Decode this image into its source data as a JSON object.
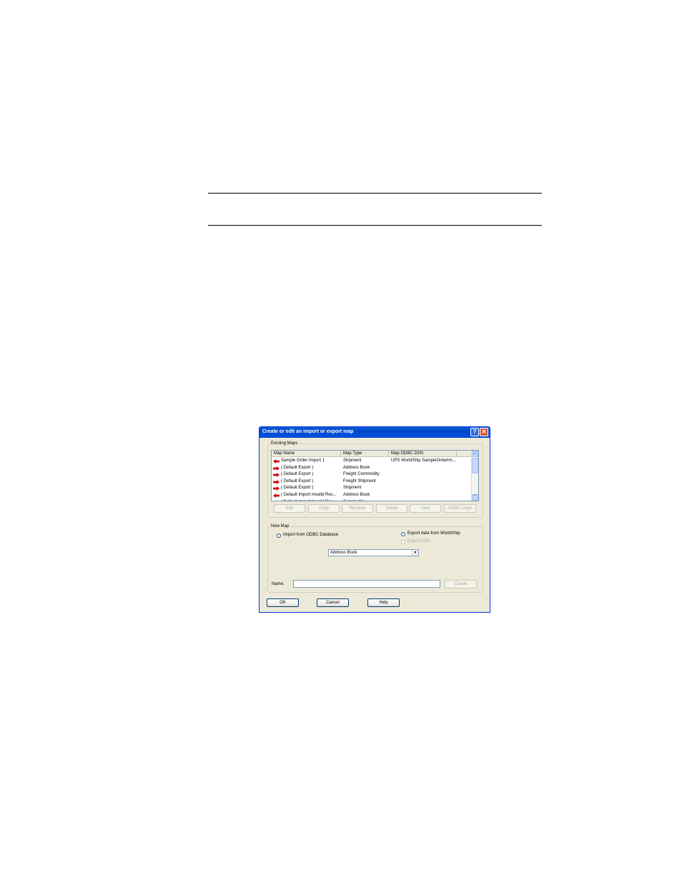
{
  "window": {
    "title": "Create or edit an import or export map",
    "help_glyph": "?",
    "close_glyph": "✕"
  },
  "existing_maps": {
    "legend": "Existing Maps",
    "columns": [
      "Map Name",
      "Map Type",
      "Map ODBC DSN"
    ],
    "rows": [
      {
        "direction": "import",
        "name": "Sample Order Import 1",
        "type": "Shipment",
        "dsn": "UPS WorldShip SampleOrderIm..."
      },
      {
        "direction": "export",
        "name": "( Default Export )",
        "type": "Address Book",
        "dsn": ""
      },
      {
        "direction": "export",
        "name": "( Default Export )",
        "type": "Freight Commodity",
        "dsn": ""
      },
      {
        "direction": "export",
        "name": "( Default Export )",
        "type": "Freight Shipment",
        "dsn": ""
      },
      {
        "direction": "export",
        "name": "( Default Export )",
        "type": "Shipment",
        "dsn": ""
      },
      {
        "direction": "import",
        "name": "( Default Import Invalid Rec...",
        "type": "Address Book",
        "dsn": ""
      },
      {
        "direction": "import",
        "name": "( Default Import Invalid Rec...",
        "type": "Commodity",
        "dsn": ""
      }
    ],
    "buttons": {
      "edit": "Edit",
      "copy": "Copy",
      "rename": "Rename",
      "delete": "Delete",
      "view": "View",
      "odbc_login": "ODBC Login"
    }
  },
  "new_map": {
    "legend": "New Map",
    "import_option": "Import from ODBC Database",
    "export_option": "Export data from WorldShip",
    "export_csv": "Export CSV",
    "type_selected": "Address Book",
    "name_label": "Name:",
    "name_value": "",
    "create_button": "Create"
  },
  "footer": {
    "ok": "OK",
    "cancel": "Cancel",
    "help": "Help"
  },
  "colors": {
    "title_bar": "#0053e0",
    "dialog_bg": "#ece9d8",
    "arrow_red": "#d40000"
  }
}
